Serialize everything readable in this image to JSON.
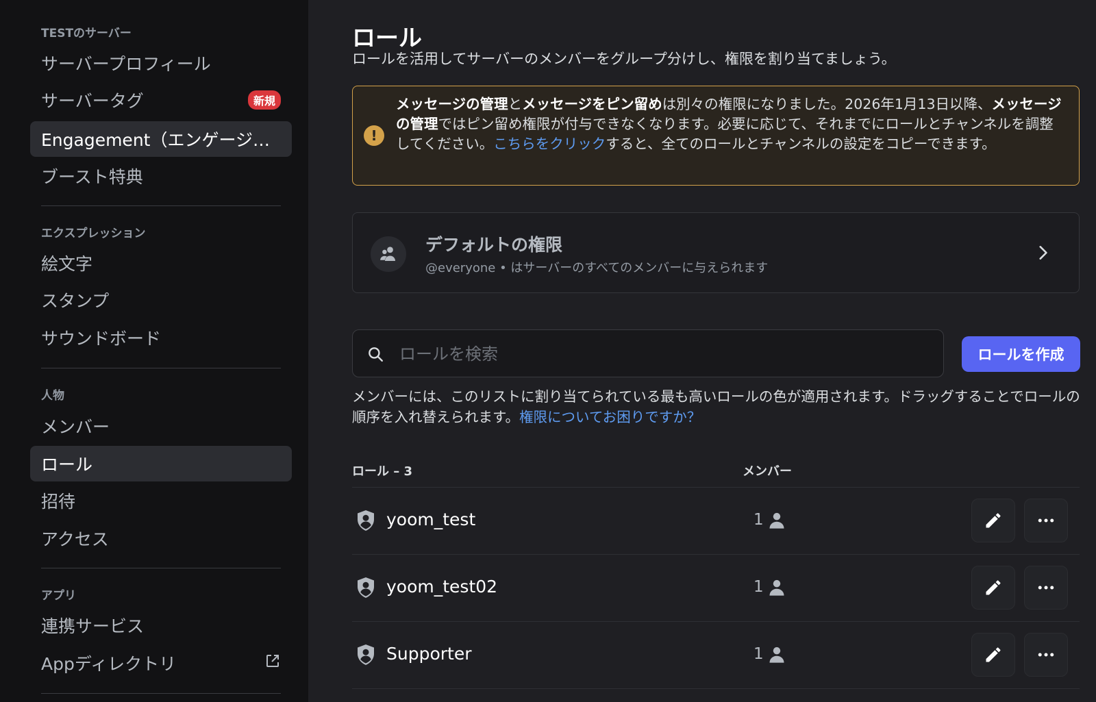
{
  "sidebar": {
    "sections": [
      {
        "title": "TESTのサーバー",
        "items": [
          {
            "label": "サーバープロフィール"
          },
          {
            "label": "サーバータグ",
            "badge": "新規"
          },
          {
            "label": "Engagement（エンゲージメ…",
            "selected": true
          },
          {
            "label": "ブースト特典"
          }
        ]
      },
      {
        "title": "エクスプレッション",
        "items": [
          {
            "label": "絵文字"
          },
          {
            "label": "スタンプ"
          },
          {
            "label": "サウンドボード"
          }
        ]
      },
      {
        "title": "人物",
        "items": [
          {
            "label": "メンバー"
          },
          {
            "label": "ロール",
            "selected": true
          },
          {
            "label": "招待"
          },
          {
            "label": "アクセス"
          }
        ]
      },
      {
        "title": "アプリ",
        "items": [
          {
            "label": "連携サービス"
          },
          {
            "label": "Appディレクトリ",
            "icon": "external-link-icon"
          }
        ]
      }
    ]
  },
  "main": {
    "title": "ロール",
    "subtitle": "ロールを活用してサーバーのメンバーをグループ分けし、権限を割り当てましょう。",
    "warning": {
      "icon": "exclamation-icon",
      "bold1": "メッセージの管理",
      "text1": "と",
      "bold2": "メッセージをピン留め",
      "text2": "は別々の権限になりました。2026年1月13日以降、",
      "bold3": "メッセージの管理",
      "text3": "ではピン留め権限が付与できなくなります。必要に応じて、それまでにロールとチャンネルを調整してください。",
      "link": "こちらをクリック",
      "text4": "すると、全てのロールとチャンネルの設定をコピーできます。"
    },
    "default_permissions": {
      "title": "デフォルトの権限",
      "description": "@everyone • はサーバーのすべてのメンバーに与えられます"
    },
    "search": {
      "placeholder": "ロールを検索",
      "value": ""
    },
    "create_button": "ロールを作成",
    "info_text": "メンバーには、このリストに割り当てられている最も高いロールの色が適用されます。ドラッグすることでロールの順序を入れ替えられます。",
    "info_link": "権限についてお困りですか？",
    "table": {
      "header_roles": "ロール – 3",
      "header_members": "メンバー",
      "rows": [
        {
          "name": "yoom_test",
          "members": "1"
        },
        {
          "name": "yoom_test02",
          "members": "1"
        },
        {
          "name": "Supporter",
          "members": "1"
        }
      ]
    }
  },
  "colors": {
    "accent": "#5865f2",
    "warning": "#d4a24a",
    "link": "#5e9bf0",
    "badge": "#da373c"
  }
}
